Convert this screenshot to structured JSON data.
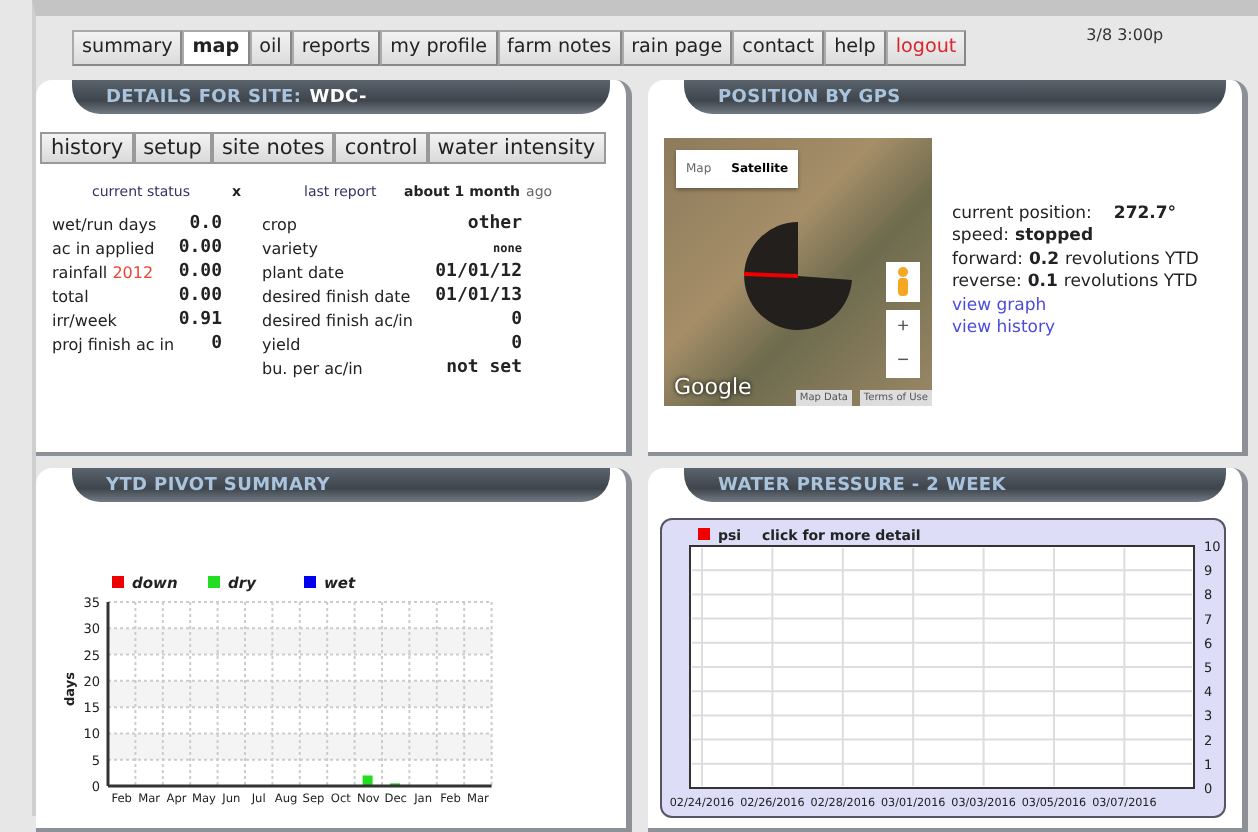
{
  "nav": {
    "tabs": [
      {
        "label": "summary",
        "selected": false,
        "kind": "normal"
      },
      {
        "label": "map",
        "selected": true,
        "kind": "normal"
      },
      {
        "label": "oil",
        "selected": false,
        "kind": "normal"
      },
      {
        "label": "reports",
        "selected": false,
        "kind": "normal"
      },
      {
        "label": "my profile",
        "selected": false,
        "kind": "normal"
      },
      {
        "label": "farm notes",
        "selected": false,
        "kind": "normal"
      },
      {
        "label": "rain page",
        "selected": false,
        "kind": "normal"
      },
      {
        "label": "contact",
        "selected": false,
        "kind": "normal"
      },
      {
        "label": "help",
        "selected": false,
        "kind": "normal"
      },
      {
        "label": "logout",
        "selected": false,
        "kind": "danger"
      }
    ],
    "timestamp": "3/8 3:00p"
  },
  "details": {
    "title": "DETAILS FOR SITE:",
    "site": "WDC-",
    "buttons": [
      "history",
      "setup",
      "site notes",
      "control",
      "water intensity"
    ],
    "status": {
      "status_label": "current status",
      "status_value": "x",
      "report_label": "last report",
      "report_value": "about 1 month",
      "report_suffix": "ago"
    },
    "left_stats": [
      {
        "label": "wet/run days",
        "value": "0.0"
      },
      {
        "label": "ac in applied",
        "value": "0.00"
      },
      {
        "label": "rainfall",
        "year": "2012",
        "value": "0.00"
      },
      {
        "label": "total",
        "value": "0.00"
      },
      {
        "label": "irr/week",
        "value": "0.91"
      },
      {
        "label": "proj finish ac in",
        "value": "0"
      }
    ],
    "right_stats": [
      {
        "label": "crop",
        "value": "other"
      },
      {
        "label": "variety",
        "value": "none",
        "kind": "small"
      },
      {
        "label": "plant date",
        "value": "01/01/12"
      },
      {
        "label": "desired finish date",
        "value": "01/01/13"
      },
      {
        "label": "desired finish ac/in",
        "value": "0"
      },
      {
        "label": "yield",
        "value": "0"
      },
      {
        "label": "bu. per ac/in",
        "value": "not set"
      }
    ]
  },
  "gps": {
    "title": "POSITION BY GPS",
    "map": {
      "map_types": [
        {
          "label": "Map",
          "selected": false
        },
        {
          "label": "Satellite",
          "selected": true
        }
      ],
      "zoom_in": "+",
      "zoom_out": "−",
      "logo": "Google",
      "map_data": "Map Data",
      "terms": "Terms of Use"
    },
    "position_label": "current position:",
    "position_value": "272.7°",
    "speed_label": "speed:",
    "speed_value": "stopped",
    "revolutions": [
      {
        "label": "forward:",
        "value": "0.2",
        "suffix": "revolutions YTD"
      },
      {
        "label": "reverse:",
        "value": "0.1",
        "suffix": "revolutions YTD"
      }
    ],
    "links": [
      "view graph",
      "view history"
    ]
  },
  "pivot_summary": {
    "title": "YTD PIVOT SUMMARY",
    "chart_data": {
      "type": "bar",
      "ylabel": "days",
      "stacked": true,
      "categories": [
        "Feb",
        "Mar",
        "Apr",
        "May",
        "Jun",
        "Jul",
        "Aug",
        "Sep",
        "Oct",
        "Nov",
        "Dec",
        "Jan",
        "Feb",
        "Mar"
      ],
      "series": [
        {
          "name": "down",
          "color": "#ee0000",
          "values": [
            0,
            0,
            0,
            0,
            0,
            0,
            0,
            0,
            0,
            0,
            0,
            0,
            0,
            0
          ]
        },
        {
          "name": "dry",
          "color": "#22dd22",
          "values": [
            0,
            0,
            0,
            0,
            0,
            0,
            0,
            0,
            0,
            2,
            0.5,
            0,
            0,
            0
          ]
        },
        {
          "name": "wet",
          "color": "#0000ee",
          "values": [
            0,
            0,
            0,
            0,
            0,
            0,
            0,
            0,
            0,
            0,
            0,
            0,
            0,
            0
          ]
        }
      ],
      "ylim": [
        0,
        35
      ],
      "yticks": [
        0,
        5,
        10,
        15,
        20,
        25,
        30,
        35
      ],
      "grid": true
    }
  },
  "water_pressure": {
    "title": "WATER PRESSURE - 2 WEEK",
    "legend_note": "click for more detail",
    "chart_data": {
      "type": "line",
      "x": [
        "02/24/2016",
        "02/26/2016",
        "02/28/2016",
        "03/01/2016",
        "03/03/2016",
        "03/05/2016",
        "03/07/2016"
      ],
      "series": [
        {
          "name": "psi",
          "color": "#ee0000",
          "values": [
            null,
            null,
            null,
            null,
            null,
            null,
            null
          ]
        }
      ],
      "ylim": [
        0,
        10
      ],
      "yticks": [
        0,
        1,
        2,
        3,
        4,
        5,
        6,
        7,
        8,
        9,
        10
      ],
      "grid": true
    }
  }
}
